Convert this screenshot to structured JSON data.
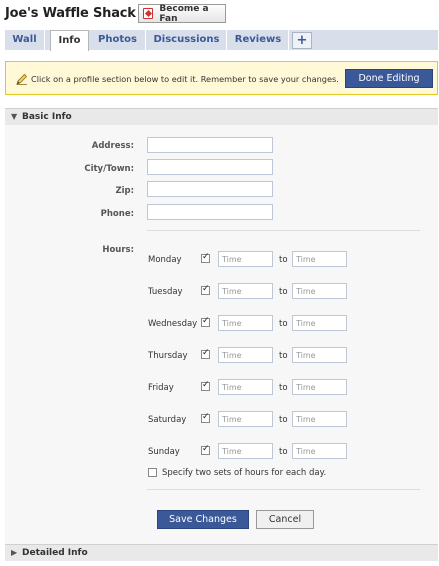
{
  "header": {
    "title": "Joe's Waffle Shack",
    "fan_button_label": "Become a Fan"
  },
  "tabs": [
    {
      "label": "Wall",
      "active": false
    },
    {
      "label": "Info",
      "active": true
    },
    {
      "label": "Photos",
      "active": false
    },
    {
      "label": "Discussions",
      "active": false
    },
    {
      "label": "Reviews",
      "active": false
    }
  ],
  "add_tab_label": "+",
  "notice": {
    "text": "Click on a profile section below to edit it. Remember to save your changes.",
    "done_button_label": "Done Editing"
  },
  "basic_info": {
    "section_title": "Basic Info",
    "fields": [
      {
        "label": "Address:",
        "value": ""
      },
      {
        "label": "City/Town:",
        "value": ""
      },
      {
        "label": "Zip:",
        "value": ""
      },
      {
        "label": "Phone:",
        "value": ""
      }
    ],
    "hours_label": "Hours:",
    "time_placeholder": "Time",
    "to_label": "to",
    "days": [
      {
        "name": "Monday",
        "checked": true
      },
      {
        "name": "Tuesday",
        "checked": true
      },
      {
        "name": "Wednesday",
        "checked": true
      },
      {
        "name": "Thursday",
        "checked": true
      },
      {
        "name": "Friday",
        "checked": true
      },
      {
        "name": "Saturday",
        "checked": true
      },
      {
        "name": "Sunday",
        "checked": true
      }
    ],
    "two_sets_label": "Specify two sets of hours for each day.",
    "two_sets_checked": false,
    "save_button_label": "Save Changes",
    "cancel_button_label": "Cancel"
  },
  "detailed_info": {
    "section_title": "Detailed Info"
  },
  "colors": {
    "link_blue": "#3b5998",
    "tab_bar": "#d8dfea",
    "notice_bg": "#fff9d7",
    "notice_border": "#e2c822"
  }
}
